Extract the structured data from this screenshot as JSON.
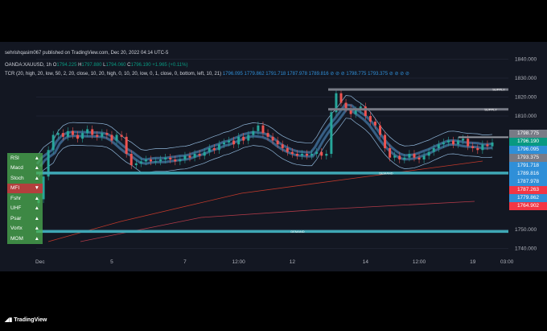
{
  "header": {
    "publisher": "sehrishqasim067 published on TradingView.com, Dec 20, 2022 04:14 UTC-5",
    "symbol": "OANDA:XAUUSD, 1h",
    "o_label": "O",
    "o": "1794.225",
    "h_label": "H",
    "h": "1797.880",
    "l_label": "L",
    "l": "1794.060",
    "c_label": "C",
    "c": "1796.190",
    "change": "+1.965 (+0.11%)",
    "indicator": "TCR (20, high, 20, low, 50, 2, 20, close, 10, 20, high, 0, 10, 20, low, 0, 1, close, 0, bottom, left, 10, 21)",
    "ind_values": [
      "1796.095",
      "1779.862",
      "1791.718",
      "1787.978",
      "1789.816",
      "⊘",
      "⊘",
      "⊘",
      "1798.775",
      "1793.375",
      "⊘",
      "⊘",
      "⊘",
      "⊘"
    ]
  },
  "indicator_panel": [
    {
      "label": "RSI",
      "dir": "▲"
    },
    {
      "label": "Macd",
      "dir": "▲"
    },
    {
      "label": "Stoch",
      "dir": "▲"
    },
    {
      "label": "MFI",
      "dir": "▼"
    },
    {
      "label": "Fshr",
      "dir": "▲"
    },
    {
      "label": "UHF",
      "dir": "▲"
    },
    {
      "label": "Psar",
      "dir": "▲"
    },
    {
      "label": "Vortx",
      "dir": "▲"
    },
    {
      "label": "MOM",
      "dir": "▲"
    }
  ],
  "price_labels": [
    {
      "v": "1798.775",
      "c": "#787b86",
      "p": 1798.775
    },
    {
      "v": "1796.190",
      "c": "#089981",
      "p": 1796.19
    },
    {
      "v": "1796.095",
      "c": "#2f8fd8",
      "p": 1796.095
    },
    {
      "v": "1793.375",
      "c": "#787b86",
      "p": 1793.375
    },
    {
      "v": "1791.718",
      "c": "#2f8fd8",
      "p": 1791.718
    },
    {
      "v": "1789.816",
      "c": "#2f8fd8",
      "p": 1789.816
    },
    {
      "v": "1787.978",
      "c": "#2f8fd8",
      "p": 1787.978
    },
    {
      "v": "1787.263",
      "c": "#f23645",
      "p": 1787.263
    },
    {
      "v": "1779.862",
      "c": "#2f8fd8",
      "p": 1779.862
    },
    {
      "v": "1764.902",
      "c": "#f23645",
      "p": 1764.902
    }
  ],
  "footer": {
    "brand": "TradingView"
  },
  "chart_data": {
    "type": "candlestick",
    "symbol": "XAUUSD",
    "timeframe": "1h",
    "y_ticks": [
      "1840.000",
      "1830.000",
      "1820.000",
      "1810.000",
      "1750.000",
      "1740.000"
    ],
    "y_tick_values": [
      1840,
      1830,
      1820,
      1810,
      1750,
      1740
    ],
    "ylim": [
      1736,
      1842
    ],
    "x_ticks": [
      "Dec",
      "5",
      "7",
      "12:00",
      "12",
      "14",
      "12:00",
      "19",
      "03:00"
    ],
    "x_tick_pos": [
      0.3,
      15,
      30,
      41,
      52,
      67,
      78,
      89,
      96
    ],
    "closes": [
      1766,
      1778,
      1792,
      1800,
      1801,
      1799,
      1802,
      1800,
      1798,
      1801,
      1803,
      1800,
      1799,
      1801,
      1800,
      1797,
      1800,
      1799,
      1790,
      1784,
      1785,
      1786,
      1787,
      1786,
      1786,
      1787,
      1788,
      1787,
      1786,
      1787,
      1789,
      1788,
      1790,
      1789,
      1791,
      1793,
      1792,
      1795,
      1796,
      1797,
      1795,
      1799,
      1797,
      1800,
      1802,
      1805,
      1801,
      1799,
      1797,
      1795,
      1793,
      1791,
      1790,
      1789,
      1790,
      1789,
      1790,
      1791,
      1789,
      1790,
      1812,
      1822,
      1817,
      1814,
      1811,
      1813,
      1815,
      1810,
      1807,
      1805,
      1800,
      1793,
      1788,
      1789,
      1787,
      1788,
      1790,
      1788,
      1787,
      1789,
      1791,
      1793,
      1795,
      1796,
      1797,
      1795,
      1797,
      1798,
      1794,
      1793,
      1792,
      1795,
      1794,
      1796
    ],
    "levels": [
      {
        "label": "SUPPLY",
        "price": 1824
      },
      {
        "label": "SUPPLY",
        "price": 1813.5
      },
      {
        "label": "DEMAND",
        "price": 1779.862
      },
      {
        "label": "DEMAND",
        "price": 1749
      }
    ]
  }
}
